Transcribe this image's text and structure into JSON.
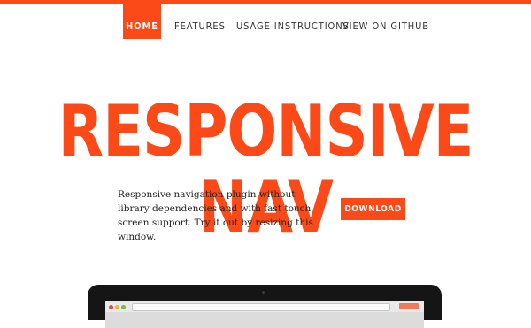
{
  "colors": {
    "accent": "#fb4a17",
    "text": "#222222"
  },
  "nav": {
    "items": [
      {
        "label": "HOME",
        "active": true
      },
      {
        "label": "FEATURES",
        "active": false
      },
      {
        "label": "USAGE INSTRUCTIONS",
        "active": false
      },
      {
        "label": "VIEW ON GITHUB",
        "active": false
      }
    ]
  },
  "hero": {
    "title": "RESPONSIVE NAV",
    "tagline": "Responsive navigation plugin without library dependencies and with fast touch screen support. Try it out by resizing this window.",
    "download_label": "DOWNLOAD"
  }
}
